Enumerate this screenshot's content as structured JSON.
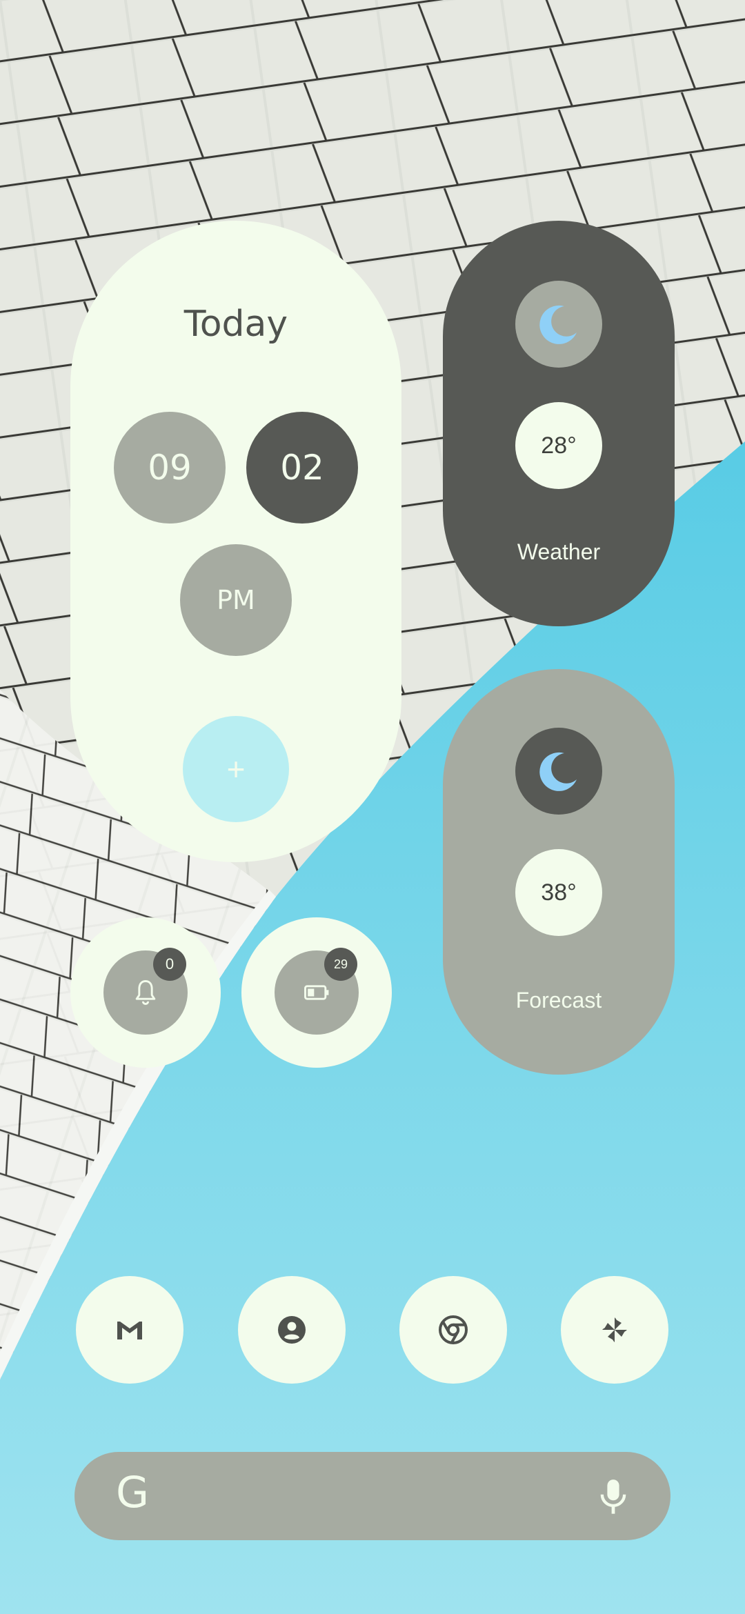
{
  "today_widget": {
    "title": "Today",
    "hour": "09",
    "minute": "02",
    "meridiem": "PM",
    "add_label": "+"
  },
  "weather_widget": {
    "temperature": "28°",
    "label": "Weather",
    "icon": "moon-icon"
  },
  "forecast_widget": {
    "temperature": "38°",
    "label": "Forecast",
    "icon": "moon-icon"
  },
  "notifications_widget": {
    "icon": "bell-icon",
    "count": "0"
  },
  "battery_widget": {
    "icon": "battery-icon",
    "level": "29"
  },
  "dock": {
    "apps": [
      {
        "icon": "gmail-icon"
      },
      {
        "icon": "contacts-icon"
      },
      {
        "icon": "chrome-icon"
      },
      {
        "icon": "pinwheel-icon"
      }
    ]
  },
  "search_bar": {
    "logo": "G",
    "mic_icon": "mic-icon"
  },
  "colors": {
    "cream": "#f3fcec",
    "dark_gray": "#575955",
    "mid_gray": "#a6aba1",
    "light_cyan": "#b8eef2",
    "moon_blue": "#8fd0f7",
    "sky_blue": "#4cc6e2"
  }
}
